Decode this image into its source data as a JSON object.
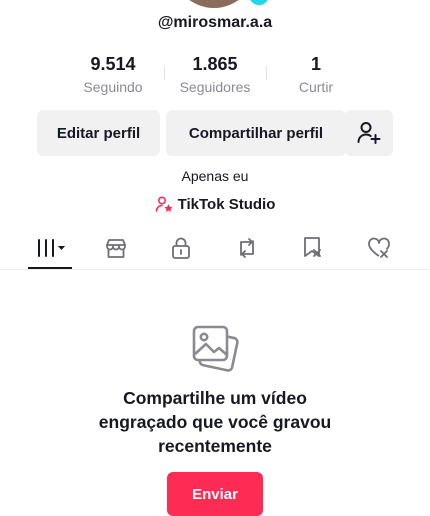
{
  "profile": {
    "username": "@mirosmar.a.a",
    "privacy_label": "Apenas eu",
    "studio_label": "TikTok Studio"
  },
  "stats": [
    {
      "value": "9.514",
      "label": "Seguindo"
    },
    {
      "value": "1.865",
      "label": "Seguidores"
    },
    {
      "value": "1",
      "label": "Curtir"
    }
  ],
  "actions": {
    "edit_label": "Editar perfil",
    "share_label": "Compartilhar perfil",
    "add_friend_icon": "add-user-icon"
  },
  "tabs": [
    {
      "icon": "videos-grid-icon",
      "selected": true
    },
    {
      "icon": "shop-icon"
    },
    {
      "icon": "lock-icon"
    },
    {
      "icon": "repost-icon"
    },
    {
      "icon": "favorites-icon"
    },
    {
      "icon": "liked-icon"
    }
  ],
  "empty_state": {
    "icon": "photos-icon",
    "line1": "Compartilhe um vídeo",
    "line2": "engraçado que você gravou",
    "line3": "recentemente",
    "button_label": "Enviar"
  },
  "colors": {
    "accent": "#fe2c55",
    "text": "#161823",
    "muted": "#8a8b91",
    "button_bg": "#f1f1f2"
  }
}
